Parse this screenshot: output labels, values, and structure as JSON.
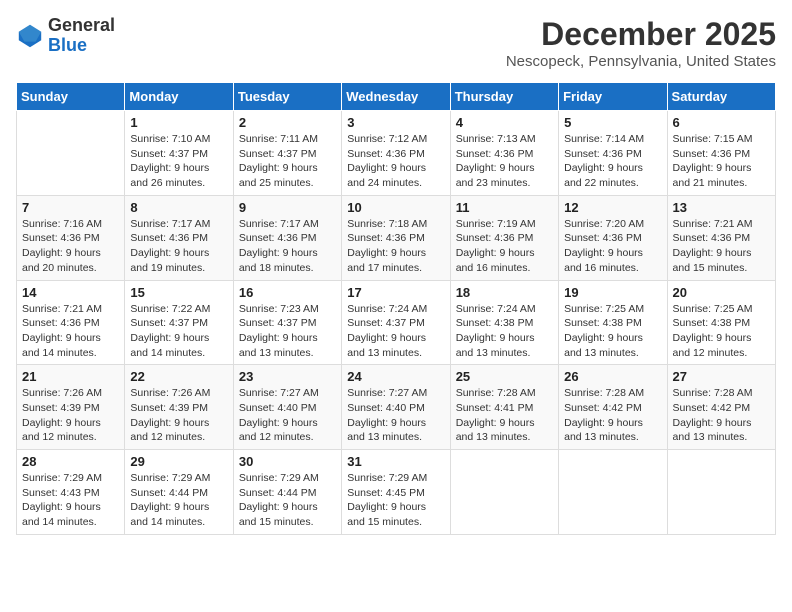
{
  "header": {
    "logo_line1": "General",
    "logo_line2": "Blue",
    "title": "December 2025",
    "subtitle": "Nescopeck, Pennsylvania, United States"
  },
  "weekdays": [
    "Sunday",
    "Monday",
    "Tuesday",
    "Wednesday",
    "Thursday",
    "Friday",
    "Saturday"
  ],
  "weeks": [
    [
      {
        "day": "",
        "info": ""
      },
      {
        "day": "1",
        "info": "Sunrise: 7:10 AM\nSunset: 4:37 PM\nDaylight: 9 hours\nand 26 minutes."
      },
      {
        "day": "2",
        "info": "Sunrise: 7:11 AM\nSunset: 4:37 PM\nDaylight: 9 hours\nand 25 minutes."
      },
      {
        "day": "3",
        "info": "Sunrise: 7:12 AM\nSunset: 4:36 PM\nDaylight: 9 hours\nand 24 minutes."
      },
      {
        "day": "4",
        "info": "Sunrise: 7:13 AM\nSunset: 4:36 PM\nDaylight: 9 hours\nand 23 minutes."
      },
      {
        "day": "5",
        "info": "Sunrise: 7:14 AM\nSunset: 4:36 PM\nDaylight: 9 hours\nand 22 minutes."
      },
      {
        "day": "6",
        "info": "Sunrise: 7:15 AM\nSunset: 4:36 PM\nDaylight: 9 hours\nand 21 minutes."
      }
    ],
    [
      {
        "day": "7",
        "info": "Sunrise: 7:16 AM\nSunset: 4:36 PM\nDaylight: 9 hours\nand 20 minutes."
      },
      {
        "day": "8",
        "info": "Sunrise: 7:17 AM\nSunset: 4:36 PM\nDaylight: 9 hours\nand 19 minutes."
      },
      {
        "day": "9",
        "info": "Sunrise: 7:17 AM\nSunset: 4:36 PM\nDaylight: 9 hours\nand 18 minutes."
      },
      {
        "day": "10",
        "info": "Sunrise: 7:18 AM\nSunset: 4:36 PM\nDaylight: 9 hours\nand 17 minutes."
      },
      {
        "day": "11",
        "info": "Sunrise: 7:19 AM\nSunset: 4:36 PM\nDaylight: 9 hours\nand 16 minutes."
      },
      {
        "day": "12",
        "info": "Sunrise: 7:20 AM\nSunset: 4:36 PM\nDaylight: 9 hours\nand 16 minutes."
      },
      {
        "day": "13",
        "info": "Sunrise: 7:21 AM\nSunset: 4:36 PM\nDaylight: 9 hours\nand 15 minutes."
      }
    ],
    [
      {
        "day": "14",
        "info": "Sunrise: 7:21 AM\nSunset: 4:36 PM\nDaylight: 9 hours\nand 14 minutes."
      },
      {
        "day": "15",
        "info": "Sunrise: 7:22 AM\nSunset: 4:37 PM\nDaylight: 9 hours\nand 14 minutes."
      },
      {
        "day": "16",
        "info": "Sunrise: 7:23 AM\nSunset: 4:37 PM\nDaylight: 9 hours\nand 13 minutes."
      },
      {
        "day": "17",
        "info": "Sunrise: 7:24 AM\nSunset: 4:37 PM\nDaylight: 9 hours\nand 13 minutes."
      },
      {
        "day": "18",
        "info": "Sunrise: 7:24 AM\nSunset: 4:38 PM\nDaylight: 9 hours\nand 13 minutes."
      },
      {
        "day": "19",
        "info": "Sunrise: 7:25 AM\nSunset: 4:38 PM\nDaylight: 9 hours\nand 13 minutes."
      },
      {
        "day": "20",
        "info": "Sunrise: 7:25 AM\nSunset: 4:38 PM\nDaylight: 9 hours\nand 12 minutes."
      }
    ],
    [
      {
        "day": "21",
        "info": "Sunrise: 7:26 AM\nSunset: 4:39 PM\nDaylight: 9 hours\nand 12 minutes."
      },
      {
        "day": "22",
        "info": "Sunrise: 7:26 AM\nSunset: 4:39 PM\nDaylight: 9 hours\nand 12 minutes."
      },
      {
        "day": "23",
        "info": "Sunrise: 7:27 AM\nSunset: 4:40 PM\nDaylight: 9 hours\nand 12 minutes."
      },
      {
        "day": "24",
        "info": "Sunrise: 7:27 AM\nSunset: 4:40 PM\nDaylight: 9 hours\nand 13 minutes."
      },
      {
        "day": "25",
        "info": "Sunrise: 7:28 AM\nSunset: 4:41 PM\nDaylight: 9 hours\nand 13 minutes."
      },
      {
        "day": "26",
        "info": "Sunrise: 7:28 AM\nSunset: 4:42 PM\nDaylight: 9 hours\nand 13 minutes."
      },
      {
        "day": "27",
        "info": "Sunrise: 7:28 AM\nSunset: 4:42 PM\nDaylight: 9 hours\nand 13 minutes."
      }
    ],
    [
      {
        "day": "28",
        "info": "Sunrise: 7:29 AM\nSunset: 4:43 PM\nDaylight: 9 hours\nand 14 minutes."
      },
      {
        "day": "29",
        "info": "Sunrise: 7:29 AM\nSunset: 4:44 PM\nDaylight: 9 hours\nand 14 minutes."
      },
      {
        "day": "30",
        "info": "Sunrise: 7:29 AM\nSunset: 4:44 PM\nDaylight: 9 hours\nand 15 minutes."
      },
      {
        "day": "31",
        "info": "Sunrise: 7:29 AM\nSunset: 4:45 PM\nDaylight: 9 hours\nand 15 minutes."
      },
      {
        "day": "",
        "info": ""
      },
      {
        "day": "",
        "info": ""
      },
      {
        "day": "",
        "info": ""
      }
    ]
  ]
}
